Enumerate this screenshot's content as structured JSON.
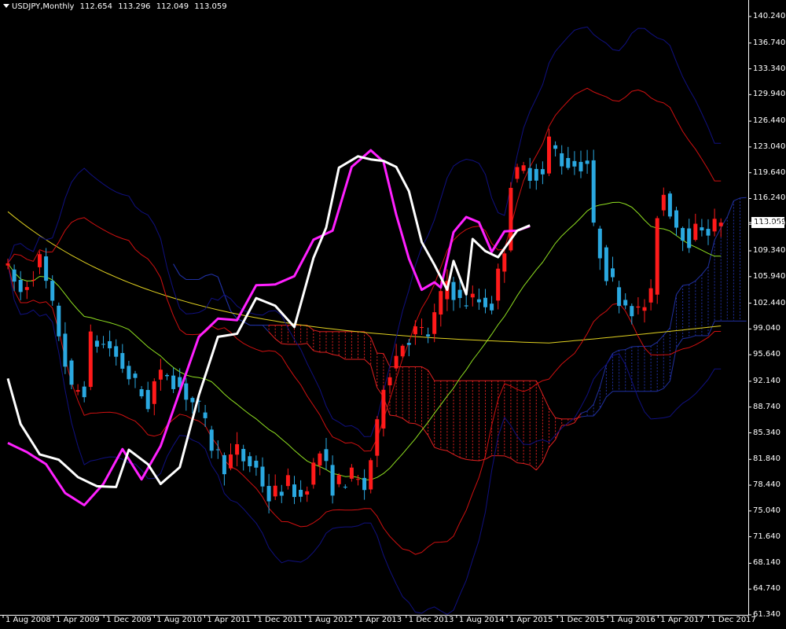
{
  "header": {
    "symbol_timeframe": "USDJPY,Monthly",
    "ohlc": [
      "112.654",
      "113.296",
      "112.049",
      "113.059"
    ]
  },
  "current_price": "113.059",
  "colors": {
    "background": "#000000",
    "axis": "#ffffff",
    "bull_candle": "#ff1a1a",
    "bear_candle": "#2aa8e0",
    "white_line": "#ffffff",
    "magenta_line": "#ff20ff",
    "ma_slow": "#e0d020",
    "bb_mid": "#90e020",
    "bb1": "#d01010",
    "bb2": "#101080",
    "cloud_bear": "#e02020",
    "cloud_bull": "#2030a0"
  },
  "chart_data": {
    "type": "candlestick",
    "instrument": "USDJPY",
    "timeframe": "Monthly",
    "ylim": [
      61.34,
      141.9
    ],
    "y_ticks": [
      "140.240",
      "136.740",
      "133.340",
      "129.940",
      "126.440",
      "123.040",
      "119.640",
      "116.240",
      "112.840",
      "109.340",
      "105.940",
      "102.440",
      "99.040",
      "95.640",
      "92.140",
      "88.740",
      "85.340",
      "81.840",
      "78.440",
      "75.040",
      "71.640",
      "68.140",
      "64.740",
      "61.340"
    ],
    "x_ticks": [
      "1 Aug 2008",
      "1 Apr 2009",
      "1 Dec 2009",
      "1 Aug 2010",
      "1 Apr 2011",
      "1 Dec 2011",
      "1 Aug 2012",
      "1 Apr 2013",
      "1 Dec 2013",
      "1 Aug 2014",
      "1 Apr 2015",
      "1 Dec 2015",
      "1 Aug 2016",
      "1 Apr 2017",
      "1 Dec 2017"
    ],
    "start_month": "2008-01",
    "trend_points": [
      [
        0,
        108.0
      ],
      [
        3,
        103.8
      ],
      [
        6,
        108.1
      ],
      [
        9,
        98.5
      ],
      [
        11,
        90.7
      ],
      [
        13,
        91.2
      ],
      [
        14,
        97.6
      ],
      [
        17,
        96.6
      ],
      [
        20,
        92.8
      ],
      [
        23,
        89.2
      ],
      [
        24,
        91.9
      ],
      [
        26,
        93.4
      ],
      [
        28,
        91.4
      ],
      [
        31,
        88.4
      ],
      [
        33,
        83.7
      ],
      [
        35,
        81.1
      ],
      [
        37,
        82.9
      ],
      [
        38,
        81.8
      ],
      [
        40,
        80.6
      ],
      [
        42,
        76.8
      ],
      [
        45,
        78.6
      ],
      [
        47,
        76.9
      ],
      [
        50,
        82.8
      ],
      [
        52,
        78.3
      ],
      [
        55,
        79.6
      ],
      [
        57,
        78.0
      ],
      [
        59,
        85.9
      ],
      [
        60,
        92.0
      ],
      [
        63,
        97.3
      ],
      [
        65,
        98.7
      ],
      [
        67,
        98.3
      ],
      [
        70,
        105.4
      ],
      [
        72,
        102.5
      ],
      [
        74,
        102.9
      ],
      [
        77,
        102.3
      ],
      [
        79,
        110.0
      ],
      [
        80,
        118.6
      ],
      [
        82,
        120.1
      ],
      [
        85,
        119.3
      ],
      [
        86,
        123.8
      ],
      [
        88,
        121.2
      ],
      [
        90,
        120.7
      ],
      [
        92,
        121.0
      ],
      [
        93,
        112.0
      ],
      [
        95,
        106.5
      ],
      [
        97,
        103.3
      ],
      [
        100,
        101.2
      ],
      [
        102,
        103.2
      ],
      [
        103,
        114.5
      ],
      [
        104,
        116.9
      ],
      [
        106,
        112.8
      ],
      [
        108,
        110.9
      ],
      [
        110,
        112.8
      ],
      [
        111,
        112.2
      ],
      [
        113,
        113.06
      ]
    ],
    "white_line": [
      [
        0,
        92.5
      ],
      [
        2,
        86.5
      ],
      [
        5,
        82.5
      ],
      [
        8,
        81.8
      ],
      [
        11,
        79.5
      ],
      [
        14,
        78.3
      ],
      [
        17,
        78.2
      ],
      [
        19,
        83.1
      ],
      [
        22,
        81.2
      ],
      [
        24,
        78.6
      ],
      [
        27,
        80.8
      ],
      [
        30,
        90.3
      ],
      [
        33,
        98.0
      ],
      [
        36,
        98.4
      ],
      [
        39,
        103.1
      ],
      [
        42,
        102.1
      ],
      [
        45,
        99.3
      ],
      [
        48,
        108.4
      ],
      [
        50,
        112.4
      ],
      [
        52,
        120.3
      ],
      [
        55,
        121.8
      ],
      [
        57,
        121.4
      ],
      [
        59,
        121.2
      ],
      [
        61,
        120.4
      ],
      [
        63,
        117.2
      ],
      [
        65,
        110.5
      ],
      [
        67,
        107.5
      ],
      [
        69,
        104.2
      ],
      [
        70,
        108.0
      ],
      [
        72,
        103.6
      ],
      [
        73,
        110.9
      ],
      [
        75,
        109.3
      ],
      [
        77,
        108.5
      ],
      [
        80,
        112.0
      ],
      [
        82,
        112.7
      ]
    ],
    "magenta_line": [
      [
        0,
        84.0
      ],
      [
        3,
        82.8
      ],
      [
        6,
        81.2
      ],
      [
        9,
        77.4
      ],
      [
        12,
        75.8
      ],
      [
        15,
        78.6
      ],
      [
        18,
        83.2
      ],
      [
        21,
        79.2
      ],
      [
        24,
        83.6
      ],
      [
        27,
        90.8
      ],
      [
        30,
        98.0
      ],
      [
        33,
        100.4
      ],
      [
        36,
        100.2
      ],
      [
        39,
        104.8
      ],
      [
        42,
        104.9
      ],
      [
        45,
        106.0
      ],
      [
        48,
        110.8
      ],
      [
        51,
        112.0
      ],
      [
        54,
        120.4
      ],
      [
        57,
        122.6
      ],
      [
        59,
        121.1
      ],
      [
        61,
        114.1
      ],
      [
        63,
        108.3
      ],
      [
        65,
        104.2
      ],
      [
        67,
        105.2
      ],
      [
        68,
        104.5
      ],
      [
        70,
        111.8
      ],
      [
        72,
        113.8
      ],
      [
        74,
        113.1
      ],
      [
        76,
        109.2
      ],
      [
        78,
        111.9
      ],
      [
        80,
        112.0
      ],
      [
        82,
        112.6
      ]
    ]
  }
}
